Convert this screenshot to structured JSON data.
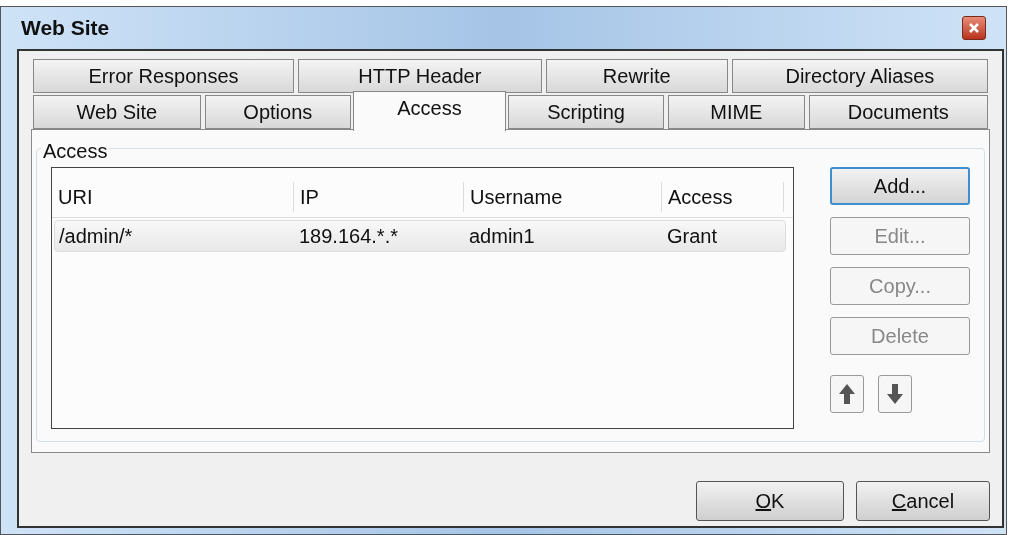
{
  "window": {
    "title": "Web Site"
  },
  "tab_rows": [
    [
      {
        "label": "Error Responses",
        "selected": false
      },
      {
        "label": "HTTP Header",
        "selected": false
      },
      {
        "label": "Rewrite",
        "selected": false
      },
      {
        "label": "Directory Aliases",
        "selected": false
      }
    ],
    [
      {
        "label": "Web Site",
        "selected": false
      },
      {
        "label": "Options",
        "selected": false
      },
      {
        "label": "Access",
        "selected": true
      },
      {
        "label": "Scripting",
        "selected": false
      },
      {
        "label": "MIME",
        "selected": false
      },
      {
        "label": "Documents",
        "selected": false
      }
    ]
  ],
  "group": {
    "title": "Access"
  },
  "table": {
    "columns": [
      "URI",
      "IP",
      "Username",
      "Access"
    ],
    "rows": [
      {
        "cells": [
          "/admin/*",
          "189.164.*.*",
          "admin1",
          "Grant"
        ],
        "selected": true
      }
    ]
  },
  "side_buttons": [
    {
      "label": "Add...",
      "disabled": false,
      "focused": true
    },
    {
      "label": "Edit...",
      "disabled": true,
      "focused": false
    },
    {
      "label": "Copy...",
      "disabled": true,
      "focused": false
    },
    {
      "label": "Delete",
      "disabled": true,
      "focused": false
    }
  ],
  "footer_buttons": [
    {
      "accel": "O",
      "rest": "K"
    },
    {
      "accel": "C",
      "rest": "ancel"
    }
  ]
}
